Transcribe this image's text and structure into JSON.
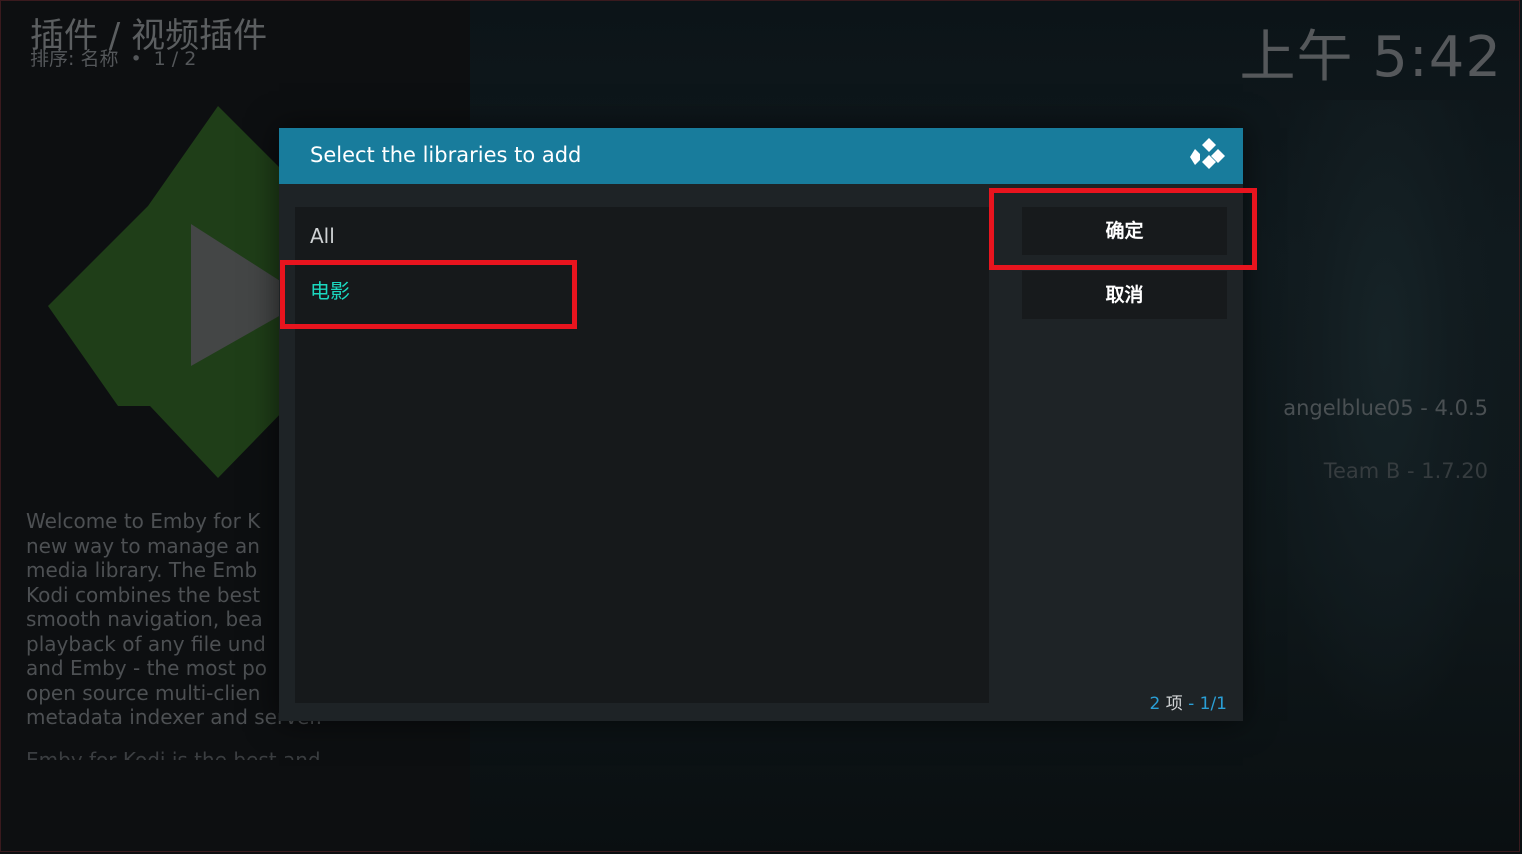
{
  "header": {
    "title": "插件 / 视频插件",
    "sort_label": "排序: 名称",
    "separator": "•",
    "page": "1 / 2"
  },
  "clock": "上午 5:42",
  "addon": {
    "description": "Welcome to Emby for K\nnew way to manage an\nmedia library. The Emb\nKodi combines the best\nsmooth navigation, bea\nplayback of any file und\nand Emby - the most po\nopen source multi-clien\nmetadata indexer and server.",
    "description_more": "Emby for Kodi is the best and seamless",
    "versions": [
      "angelblue05 - 4.0.5",
      "Team B - 1.7.20"
    ]
  },
  "dialog": {
    "title": "Select the libraries to add",
    "items": [
      {
        "label": "All",
        "focused": false
      },
      {
        "label": "电影",
        "focused": true
      }
    ],
    "buttons": {
      "ok": "确定",
      "cancel": "取消"
    },
    "count": {
      "number": "2",
      "unit": "项",
      "dash": "-",
      "page": "1/1"
    }
  },
  "colors": {
    "header_blue": "#187c9c",
    "focused_item": "#1bd8bf",
    "annotation_red": "#e8141e",
    "count_blue": "#2a9fd6"
  },
  "icons": {
    "dialog_logo": "kodi-logo-icon",
    "addon_art": "emby-logo-icon"
  }
}
